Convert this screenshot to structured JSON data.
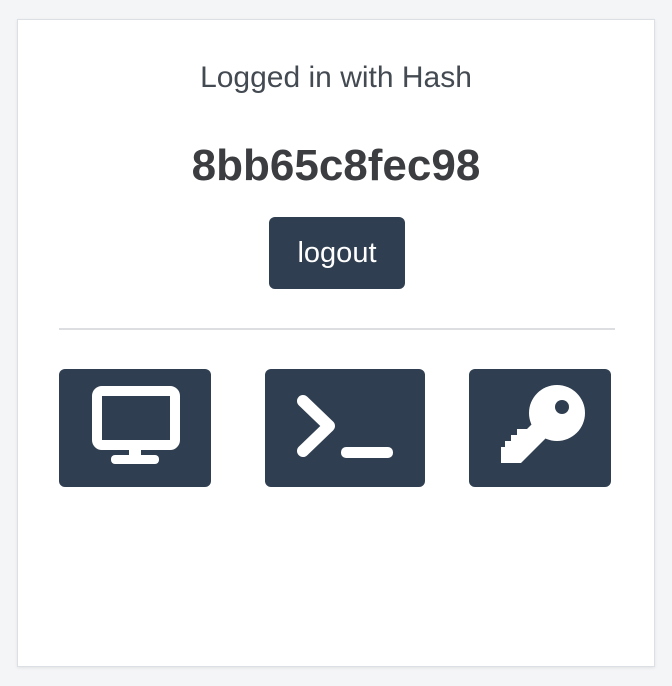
{
  "session": {
    "label": "Logged in with Hash",
    "hash": "8bb65c8fec98",
    "logout_label": "logout"
  },
  "tiles": [
    {
      "icon": "desktop-icon"
    },
    {
      "icon": "terminal-icon"
    },
    {
      "icon": "key-icon"
    }
  ],
  "colors": {
    "accent": "#2f3e50",
    "background": "#f4f5f7",
    "card": "#ffffff",
    "text": "#3b3d40"
  }
}
